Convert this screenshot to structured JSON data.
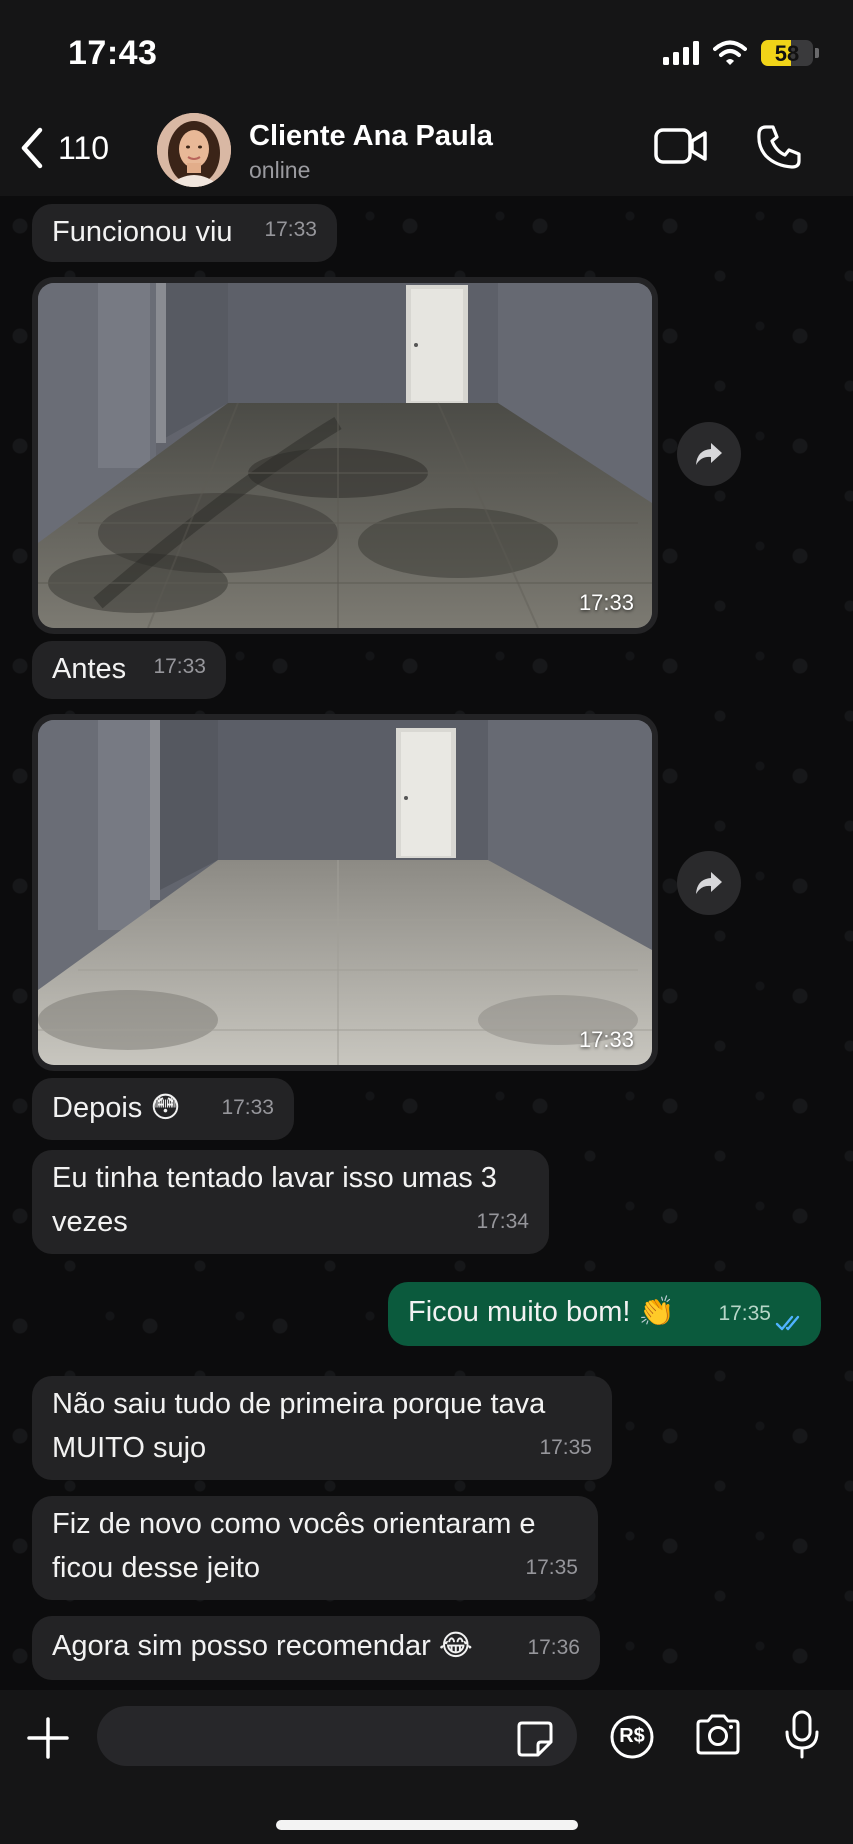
{
  "status": {
    "time": "17:43",
    "battery": "58",
    "battery_level": 0.58
  },
  "header": {
    "back_count": "110",
    "contact_name": "Cliente Ana Paula",
    "contact_status": "online"
  },
  "messages": [
    {
      "text": "Funcionou viu",
      "time": "17:33"
    },
    {
      "photo_time": "17:33",
      "caption": "before-photo"
    },
    {
      "text": "Antes",
      "time": "17:33"
    },
    {
      "photo_time": "17:33",
      "caption": "after-photo"
    },
    {
      "text": "Depois 😳",
      "time": "17:33"
    },
    {
      "text": "Eu tinha tentado lavar isso umas 3\nvezes",
      "time": "17:34"
    },
    {
      "text": "Ficou muito bom! 👏",
      "time": "17:35",
      "outgoing": true,
      "read": true
    },
    {
      "text": "Não saiu tudo de primeira porque tava\nMUITO sujo",
      "time": "17:35"
    },
    {
      "text": "Fiz de novo como vocês orientaram e\nficou desse jeito",
      "time": "17:35"
    },
    {
      "text": "Agora sim posso recomendar 😂",
      "time": "17:36"
    }
  ],
  "input": {
    "placeholder": "",
    "payment_icon_label": "R$"
  },
  "colors": {
    "outgoing_bubble": "#0b5a3d",
    "incoming_bubble": "#232325",
    "read_ticks": "#4fb3ff",
    "battery": "#f1d418"
  }
}
